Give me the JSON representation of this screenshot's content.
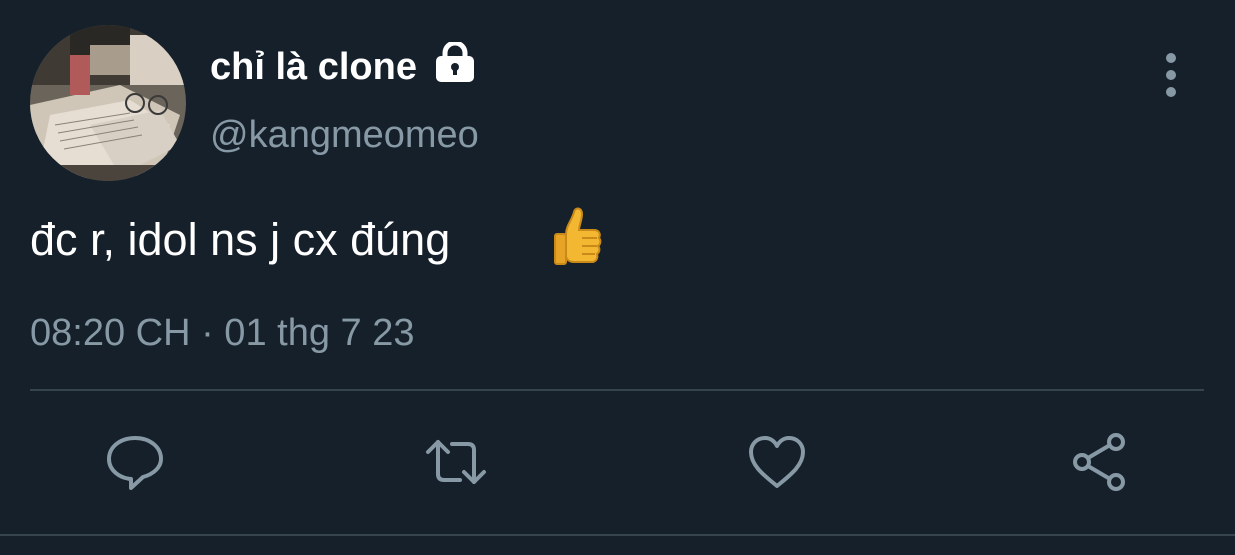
{
  "author": {
    "display_name": "chỉ là clone",
    "handle": "@kangmeomeo",
    "avatar_icon": "avatar-image",
    "protected_icon": "lock-icon"
  },
  "tweet": {
    "text": "đc r, idol ns j cx đúng",
    "emoji": "thumbs-up",
    "timestamp": "08:20 CH · 01 thg 7 23"
  },
  "actions": [
    {
      "name": "reply",
      "icon": "comment-icon"
    },
    {
      "name": "retweet",
      "icon": "retweet-icon"
    },
    {
      "name": "like",
      "icon": "heart-icon"
    },
    {
      "name": "share",
      "icon": "share-icon"
    }
  ],
  "colors": {
    "background": "#15202b",
    "primary_text": "#ffffff",
    "secondary_text": "#8899a6",
    "divider": "#38444d"
  }
}
